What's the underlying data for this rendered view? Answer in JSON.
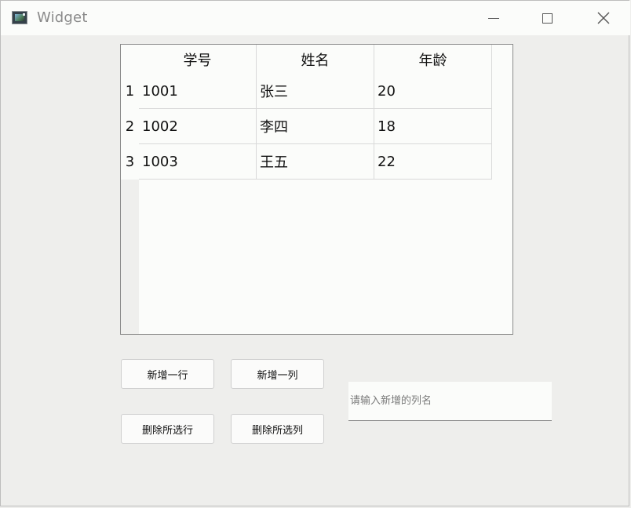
{
  "window": {
    "title": "Widget"
  },
  "table": {
    "headers": [
      "学号",
      "姓名",
      "年龄"
    ],
    "rows": [
      {
        "num": "1",
        "cells": [
          "1001",
          "张三",
          "20"
        ]
      },
      {
        "num": "2",
        "cells": [
          "1002",
          "李四",
          "18"
        ]
      },
      {
        "num": "3",
        "cells": [
          "1003",
          "王五",
          "22"
        ]
      }
    ]
  },
  "buttons": {
    "add_row": "新增一行",
    "add_col": "新增一列",
    "del_rows": "删除所选行",
    "del_cols": "删除所选列"
  },
  "input": {
    "value": "",
    "placeholder": "请输入新增的列名"
  }
}
